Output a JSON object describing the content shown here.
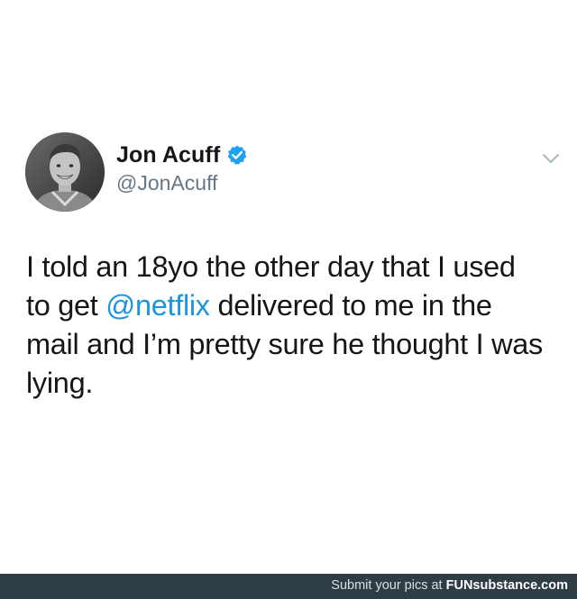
{
  "tweet": {
    "display_name": "Jon Acuff",
    "handle": "@JonAcuff",
    "verified": true,
    "text_lines": [
      {
        "before": "I told an 18yo the other day that I used",
        "mention": "",
        "after": ""
      },
      {
        "before": "to get ",
        "mention": "@netflix",
        "after": " delivered to me in the"
      },
      {
        "before": "mail and I’m pretty sure he thought I was",
        "mention": "",
        "after": ""
      },
      {
        "before": "lying.",
        "mention": "",
        "after": ""
      }
    ],
    "icons": {
      "verified": "verified-badge-icon",
      "menu": "chevron-down-icon",
      "avatar": "user-avatar"
    },
    "colors": {
      "mention": "#1b95e0",
      "verified": "#1da1f2",
      "handle": "#657786"
    }
  },
  "footer": {
    "prefix": "Submit your pics at ",
    "brand_bold": "FUN",
    "brand_rest": "substance.com"
  }
}
